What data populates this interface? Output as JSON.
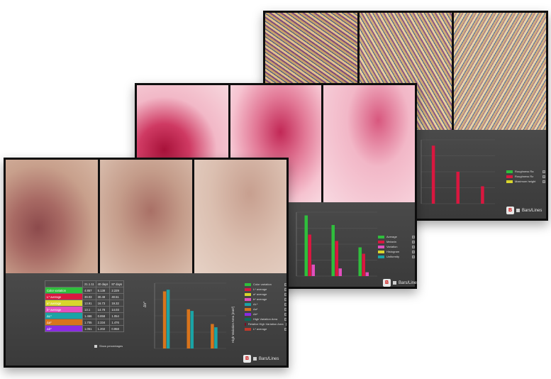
{
  "colors": {
    "monitor_frame": "#0e0e0e",
    "panel_bg": "#444444",
    "green": "#2fbe3c",
    "red": "#d9173f",
    "magenta": "#e24fbf",
    "yellow": "#d9d62c",
    "teal": "#1aa4a6",
    "orange": "#d8741c"
  },
  "back_screen": {
    "legend": [
      {
        "label": "Roughness Ra",
        "color": "#2fbe3c"
      },
      {
        "label": "Roughness Rz",
        "color": "#d9173f"
      },
      {
        "label": "Maximum height",
        "color": "#d9d62c"
      }
    ],
    "bars_lines_label": "Bars/Lines",
    "chart_data": {
      "type": "bar",
      "categories": [
        "",
        "",
        ""
      ],
      "series": [
        {
          "name": "Roughness Rz",
          "values": [
            100,
            55,
            30
          ]
        }
      ]
    }
  },
  "mid_screen": {
    "legend": [
      {
        "label": "Average",
        "color": "#2fbe3c"
      },
      {
        "label": "Melanin",
        "color": "#d9173f"
      },
      {
        "label": "Variation",
        "color": "#e24fbf"
      },
      {
        "label": "Histogram",
        "color": "#d9d62c"
      },
      {
        "label": "Uniformity",
        "color": "#1aa4a6"
      }
    ],
    "bars_lines_label": "Bars/Lines",
    "chart_data": {
      "type": "bar",
      "categories": [
        "",
        "",
        ""
      ],
      "series": [
        {
          "name": "Average",
          "values": [
            95,
            80,
            45
          ]
        },
        {
          "name": "Melanin",
          "values": [
            65,
            55,
            35
          ]
        },
        {
          "name": "Variation",
          "values": [
            18,
            12,
            6
          ]
        }
      ]
    }
  },
  "front_screen": {
    "table": {
      "headers": [
        "",
        "21.1.11",
        "40 days",
        "87 days"
      ],
      "rows": [
        {
          "label": "Color variation",
          "color": "#2fbe3c",
          "values": [
            "4.857",
            "5.138",
            "2.229"
          ]
        },
        {
          "label": "L* average",
          "color": "#d9173f",
          "values": [
            "39.03",
            "30.48",
            "40.51"
          ]
        },
        {
          "label": "a* average",
          "color": "#d9d62c",
          "values": [
            "13.91",
            "16.73",
            "19.32"
          ]
        },
        {
          "label": "b* average",
          "color": "#e24fbf",
          "values": [
            "13.1",
            "14.78",
            "14.03"
          ]
        },
        {
          "label": "ΔL*",
          "color": "#1aa4a6",
          "values": [
            "1.466",
            "0.858",
            "1.054"
          ]
        },
        {
          "label": "Δa*",
          "color": "#d8741c",
          "values": [
            "1.705",
            "2.334",
            "1.476"
          ]
        },
        {
          "label": "Δb*",
          "color": "#8a2be2",
          "values": [
            "1.051",
            "1.202",
            "0.958"
          ]
        }
      ]
    },
    "show_percentages_label": "Show percentages",
    "legend": [
      {
        "label": "Color variation",
        "color": "#2fbe3c"
      },
      {
        "label": "L* average",
        "color": "#d9173f"
      },
      {
        "label": "a* average",
        "color": "#d9d62c"
      },
      {
        "label": "b* average",
        "color": "#e24fbf"
      },
      {
        "label": "ΔL*",
        "color": "#1aa4a6"
      },
      {
        "label": "Δa*",
        "color": "#d8741c"
      },
      {
        "label": "Δb*",
        "color": "#8a2be2"
      },
      {
        "label": "High Variation Area",
        "color": "#0b6b5a"
      },
      {
        "label": "Relative High Variation Area",
        "color": "#7a0e24"
      },
      {
        "label": "L* average",
        "color": "#c0392b"
      }
    ],
    "axis_left_label": "Δb*",
    "axis_right_label": "High Variation Area [mm²]",
    "bars_lines_label": "Bars/Lines",
    "chart_data": {
      "type": "bar",
      "categories": [
        "",
        "",
        ""
      ],
      "series": [
        {
          "name": "Δa*",
          "values": [
            70,
            48,
            30
          ]
        },
        {
          "name": "ΔL*",
          "values": [
            72,
            46,
            26
          ]
        }
      ]
    }
  }
}
